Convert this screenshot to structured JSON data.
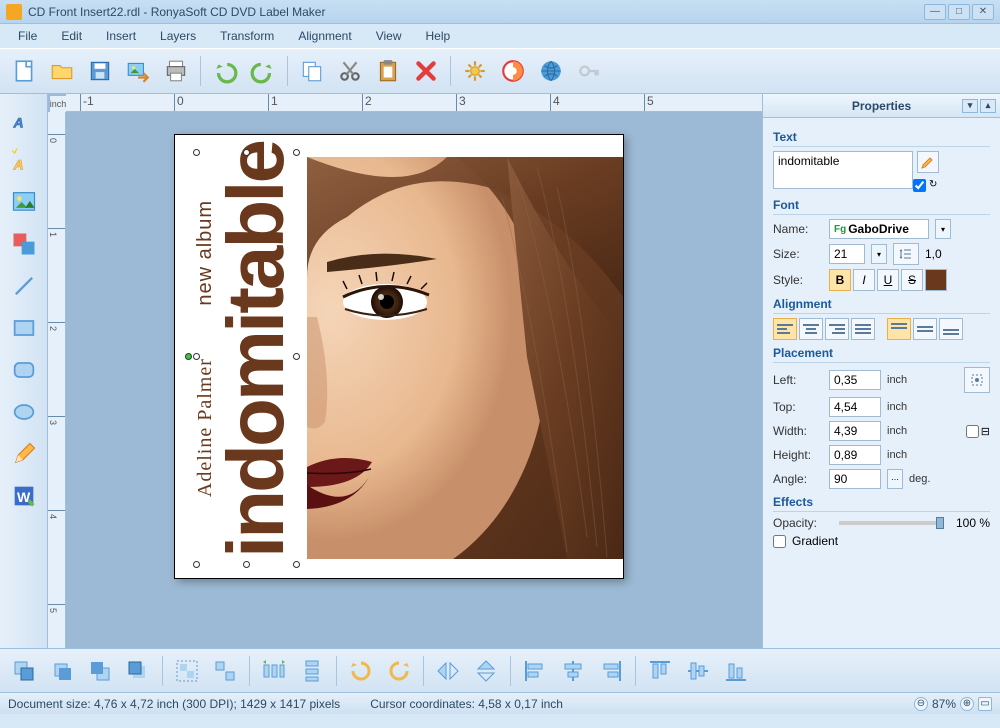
{
  "window": {
    "title": "CD Front Insert22.rdl - RonyaSoft CD DVD Label Maker"
  },
  "menu": [
    "File",
    "Edit",
    "Insert",
    "Layers",
    "Transform",
    "Alignment",
    "View",
    "Help"
  ],
  "ruler_unit": "inch",
  "ruler_marks_h": [
    "-1",
    "0",
    "1",
    "2",
    "3",
    "4",
    "5"
  ],
  "ruler_marks_v": [
    "0",
    "1",
    "2",
    "3",
    "4",
    "5"
  ],
  "canvas": {
    "album_label": "new album",
    "artist": "Adeline Palmer",
    "title_text": "indomitable"
  },
  "properties": {
    "panel_title": "Properties",
    "sections": {
      "text": "Text",
      "font": "Font",
      "alignment": "Alignment",
      "placement": "Placement",
      "effects": "Effects"
    },
    "text_value": "indomitable",
    "font": {
      "name_label": "Name:",
      "name_value": "GaboDrive",
      "size_label": "Size:",
      "size_value": "21",
      "linespace": "1,0",
      "style_label": "Style:",
      "bold": "B",
      "italic": "I",
      "underline": "U",
      "strike": "S"
    },
    "placement": {
      "left_label": "Left:",
      "left": "0,35",
      "top_label": "Top:",
      "top": "4,54",
      "width_label": "Width:",
      "width": "4,39",
      "height_label": "Height:",
      "height": "0,89",
      "angle_label": "Angle:",
      "angle": "90",
      "unit": "inch",
      "deg": "deg."
    },
    "effects": {
      "opacity_label": "Opacity:",
      "opacity_value": "100 %",
      "gradient_label": "Gradient"
    }
  },
  "status": {
    "docsize": "Document size: 4,76 x 4,72 inch (300 DPI); 1429 x 1417 pixels",
    "cursor": "Cursor coordinates: 4,58 x 0,17 inch",
    "zoom": "87%"
  }
}
